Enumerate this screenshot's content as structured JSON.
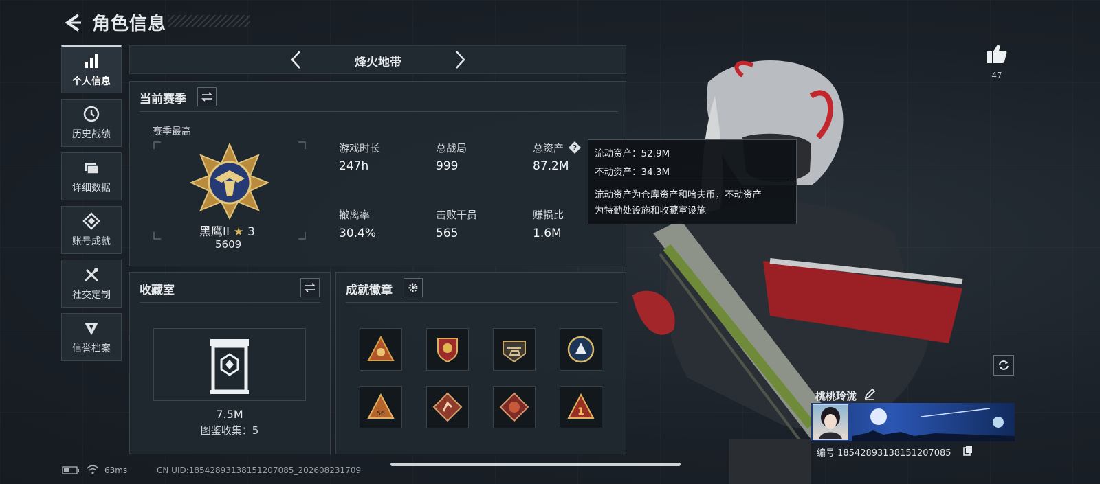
{
  "header": {
    "title": "角色信息"
  },
  "sidebar": {
    "items": [
      {
        "label": "个人信息",
        "icon": "bar-chart-icon",
        "active": true
      },
      {
        "label": "历史战绩",
        "icon": "clock-icon"
      },
      {
        "label": "详细数据",
        "icon": "folder-icon"
      },
      {
        "label": "账号成就",
        "icon": "achievement-icon"
      },
      {
        "label": "社交定制",
        "icon": "tools-icon"
      },
      {
        "label": "信誉档案",
        "icon": "credit-icon"
      }
    ]
  },
  "mode": {
    "title": "烽火地带"
  },
  "season": {
    "title": "当前赛季",
    "best_label": "赛季最高",
    "rank_name": "黑鹰II",
    "rank_stars": "3",
    "rank_score": "5609",
    "stats": [
      {
        "label": "游戏时长",
        "value": "247h"
      },
      {
        "label": "总战局",
        "value": "999"
      },
      {
        "label": "总资产",
        "value": "87.2M"
      },
      {
        "label": "撤离率",
        "value": "30.4%"
      },
      {
        "label": "击败干员",
        "value": "565"
      },
      {
        "label": "赚损比",
        "value": "1.6M"
      }
    ]
  },
  "tooltip": {
    "line1": "流动资产：52.9M",
    "line2": "不动资产：34.3M",
    "desc1": "流动资产为仓库资产和哈夫币，不动资产",
    "desc2": "为特勤处设施和收藏室设施"
  },
  "collection": {
    "title": "收藏室",
    "value": "7.5M",
    "count_label": "图鉴收集：5"
  },
  "achievements": {
    "title": "成就徽章",
    "badges": [
      "triangle-badge",
      "shield-badge",
      "helicopter-badge",
      "round-wolf-badge",
      "triangle-56-badge",
      "diamond-runner-badge",
      "diamond-dragon-badge",
      "triangle-1-badge"
    ]
  },
  "player": {
    "name": "桃桃玲泷",
    "id": "编号 18542893138151207085"
  },
  "likes": {
    "count": "47"
  },
  "status": {
    "ping": "63ms",
    "uid": "CN UID:18542893138151207085_202608231709"
  },
  "colors": {
    "accent": "#cfd6dc",
    "panel": "#212930",
    "gold": "#c9a14a",
    "red": "#c2272d"
  }
}
